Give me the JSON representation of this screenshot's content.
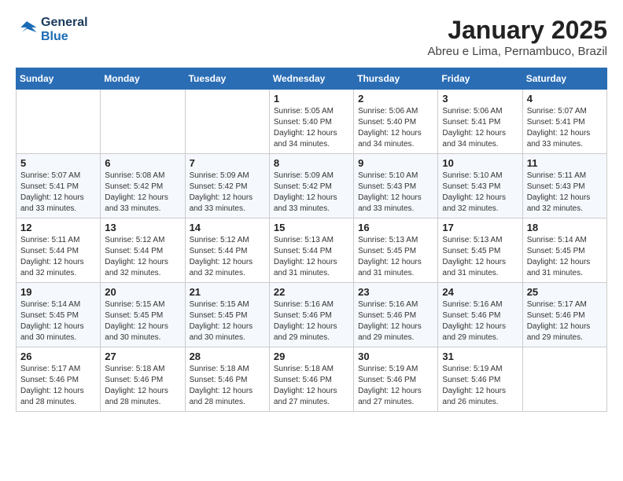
{
  "header": {
    "logo_line1": "General",
    "logo_line2": "Blue",
    "month": "January 2025",
    "location": "Abreu e Lima, Pernambuco, Brazil"
  },
  "weekdays": [
    "Sunday",
    "Monday",
    "Tuesday",
    "Wednesday",
    "Thursday",
    "Friday",
    "Saturday"
  ],
  "weeks": [
    [
      {
        "day": "",
        "detail": ""
      },
      {
        "day": "",
        "detail": ""
      },
      {
        "day": "",
        "detail": ""
      },
      {
        "day": "1",
        "detail": "Sunrise: 5:05 AM\nSunset: 5:40 PM\nDaylight: 12 hours\nand 34 minutes."
      },
      {
        "day": "2",
        "detail": "Sunrise: 5:06 AM\nSunset: 5:40 PM\nDaylight: 12 hours\nand 34 minutes."
      },
      {
        "day": "3",
        "detail": "Sunrise: 5:06 AM\nSunset: 5:41 PM\nDaylight: 12 hours\nand 34 minutes."
      },
      {
        "day": "4",
        "detail": "Sunrise: 5:07 AM\nSunset: 5:41 PM\nDaylight: 12 hours\nand 33 minutes."
      }
    ],
    [
      {
        "day": "5",
        "detail": "Sunrise: 5:07 AM\nSunset: 5:41 PM\nDaylight: 12 hours\nand 33 minutes."
      },
      {
        "day": "6",
        "detail": "Sunrise: 5:08 AM\nSunset: 5:42 PM\nDaylight: 12 hours\nand 33 minutes."
      },
      {
        "day": "7",
        "detail": "Sunrise: 5:09 AM\nSunset: 5:42 PM\nDaylight: 12 hours\nand 33 minutes."
      },
      {
        "day": "8",
        "detail": "Sunrise: 5:09 AM\nSunset: 5:42 PM\nDaylight: 12 hours\nand 33 minutes."
      },
      {
        "day": "9",
        "detail": "Sunrise: 5:10 AM\nSunset: 5:43 PM\nDaylight: 12 hours\nand 33 minutes."
      },
      {
        "day": "10",
        "detail": "Sunrise: 5:10 AM\nSunset: 5:43 PM\nDaylight: 12 hours\nand 32 minutes."
      },
      {
        "day": "11",
        "detail": "Sunrise: 5:11 AM\nSunset: 5:43 PM\nDaylight: 12 hours\nand 32 minutes."
      }
    ],
    [
      {
        "day": "12",
        "detail": "Sunrise: 5:11 AM\nSunset: 5:44 PM\nDaylight: 12 hours\nand 32 minutes."
      },
      {
        "day": "13",
        "detail": "Sunrise: 5:12 AM\nSunset: 5:44 PM\nDaylight: 12 hours\nand 32 minutes."
      },
      {
        "day": "14",
        "detail": "Sunrise: 5:12 AM\nSunset: 5:44 PM\nDaylight: 12 hours\nand 32 minutes."
      },
      {
        "day": "15",
        "detail": "Sunrise: 5:13 AM\nSunset: 5:44 PM\nDaylight: 12 hours\nand 31 minutes."
      },
      {
        "day": "16",
        "detail": "Sunrise: 5:13 AM\nSunset: 5:45 PM\nDaylight: 12 hours\nand 31 minutes."
      },
      {
        "day": "17",
        "detail": "Sunrise: 5:13 AM\nSunset: 5:45 PM\nDaylight: 12 hours\nand 31 minutes."
      },
      {
        "day": "18",
        "detail": "Sunrise: 5:14 AM\nSunset: 5:45 PM\nDaylight: 12 hours\nand 31 minutes."
      }
    ],
    [
      {
        "day": "19",
        "detail": "Sunrise: 5:14 AM\nSunset: 5:45 PM\nDaylight: 12 hours\nand 30 minutes."
      },
      {
        "day": "20",
        "detail": "Sunrise: 5:15 AM\nSunset: 5:45 PM\nDaylight: 12 hours\nand 30 minutes."
      },
      {
        "day": "21",
        "detail": "Sunrise: 5:15 AM\nSunset: 5:45 PM\nDaylight: 12 hours\nand 30 minutes."
      },
      {
        "day": "22",
        "detail": "Sunrise: 5:16 AM\nSunset: 5:46 PM\nDaylight: 12 hours\nand 29 minutes."
      },
      {
        "day": "23",
        "detail": "Sunrise: 5:16 AM\nSunset: 5:46 PM\nDaylight: 12 hours\nand 29 minutes."
      },
      {
        "day": "24",
        "detail": "Sunrise: 5:16 AM\nSunset: 5:46 PM\nDaylight: 12 hours\nand 29 minutes."
      },
      {
        "day": "25",
        "detail": "Sunrise: 5:17 AM\nSunset: 5:46 PM\nDaylight: 12 hours\nand 29 minutes."
      }
    ],
    [
      {
        "day": "26",
        "detail": "Sunrise: 5:17 AM\nSunset: 5:46 PM\nDaylight: 12 hours\nand 28 minutes."
      },
      {
        "day": "27",
        "detail": "Sunrise: 5:18 AM\nSunset: 5:46 PM\nDaylight: 12 hours\nand 28 minutes."
      },
      {
        "day": "28",
        "detail": "Sunrise: 5:18 AM\nSunset: 5:46 PM\nDaylight: 12 hours\nand 28 minutes."
      },
      {
        "day": "29",
        "detail": "Sunrise: 5:18 AM\nSunset: 5:46 PM\nDaylight: 12 hours\nand 27 minutes."
      },
      {
        "day": "30",
        "detail": "Sunrise: 5:19 AM\nSunset: 5:46 PM\nDaylight: 12 hours\nand 27 minutes."
      },
      {
        "day": "31",
        "detail": "Sunrise: 5:19 AM\nSunset: 5:46 PM\nDaylight: 12 hours\nand 26 minutes."
      },
      {
        "day": "",
        "detail": ""
      }
    ]
  ]
}
